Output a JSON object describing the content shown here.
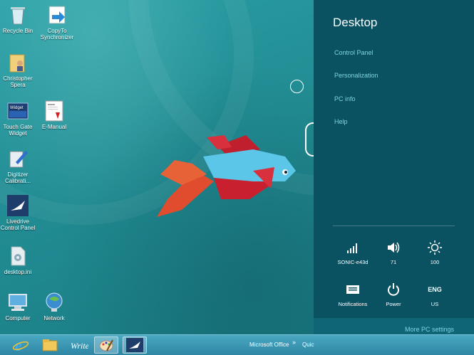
{
  "desktop": {
    "icons": [
      {
        "label": "Recycle Bin",
        "icon": "recycle-bin-icon"
      },
      {
        "label": "CopyTo\nSynchronizer",
        "icon": "copyto-icon"
      },
      {
        "label": "Christopher\nSpera",
        "icon": "user-folder-icon"
      },
      {
        "label": "Touch Gate\nWidget",
        "icon": "widget-icon"
      },
      {
        "label": "E-Manual",
        "icon": "pdf-icon"
      },
      {
        "label": "Digitizer\nCalibrati...",
        "icon": "digitizer-icon"
      },
      {
        "label": "Livedrive\nControl Panel",
        "icon": "livedrive-icon"
      },
      {
        "label": "desktop.ini",
        "icon": "ini-file-icon"
      },
      {
        "label": "Computer",
        "icon": "computer-icon"
      },
      {
        "label": "Network",
        "icon": "network-icon"
      }
    ],
    "widget_badge": "Widget"
  },
  "taskbar": {
    "start": "ie-icon",
    "apps": [
      "explorer-icon",
      "writer-icon",
      "paint-icon",
      "livedrive-icon"
    ],
    "toolbar_label": "Microsoft Office",
    "toolbar_more": "»",
    "quick_label": "Quic"
  },
  "charms": {
    "title": "Desktop",
    "links": [
      "Control Panel",
      "Personalization",
      "PC info",
      "Help"
    ],
    "status": [
      {
        "label": "SONIC-e43d",
        "icon": "wifi-signal-icon"
      },
      {
        "label": "71",
        "icon": "volume-icon"
      },
      {
        "label": "100",
        "icon": "brightness-icon"
      },
      {
        "label": "Notifications",
        "icon": "notifications-icon"
      },
      {
        "label": "Power",
        "icon": "power-icon"
      },
      {
        "label": "US",
        "icon": "keyboard-language-icon",
        "glyph_text": "ENG"
      }
    ],
    "more_settings": "More PC settings"
  },
  "colors": {
    "charms_bg": "#0a5262",
    "link": "#7fd4e4",
    "wallpaper": "#238f96",
    "taskbar": "#3a96b4"
  }
}
